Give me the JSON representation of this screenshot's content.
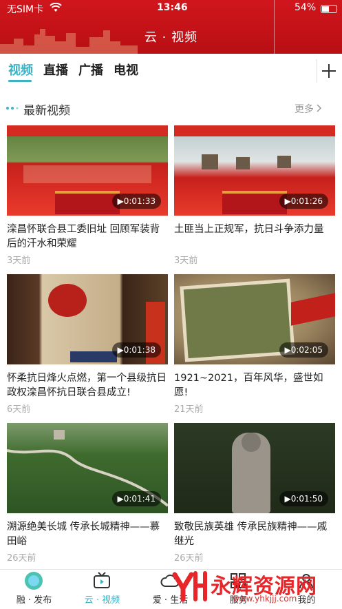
{
  "status_bar": {
    "carrier": "无SIM卡",
    "time": "13:46",
    "battery": "54%"
  },
  "colors": {
    "brand_red": "#c8141a",
    "accent": "#3cb3c3"
  },
  "header": {
    "title": "云 · 视频"
  },
  "tabs": [
    {
      "label": "视频",
      "active": true
    },
    {
      "label": "直播",
      "active": false
    },
    {
      "label": "广播",
      "active": false
    },
    {
      "label": "电视",
      "active": false
    }
  ],
  "add_icon": "plus-icon",
  "section": {
    "title": "最新视频",
    "more": "更多"
  },
  "videos": [
    {
      "title": "滦昌怀联合县工委旧址 回顾军装背后的汗水和荣耀",
      "date": "3天前",
      "duration": "0:01:33"
    },
    {
      "title": "土匪当上正规军，抗日斗争添力量",
      "date": "3天前",
      "duration": "0:01:26"
    },
    {
      "title": "怀柔抗日烽火点燃，第一个县级抗日政权滦昌怀抗日联合县成立!",
      "date": "6天前",
      "duration": "0:01:38"
    },
    {
      "title": "1921~2021，百年风华，盛世如愿!",
      "date": "21天前",
      "duration": "0:02:05"
    },
    {
      "title": "溯源绝美长城 传承长城精神——慕田峪",
      "date": "26天前",
      "duration": "0:01:41"
    },
    {
      "title": "致敬民族英雄 传承民族精神——戚继光",
      "date": "26天前",
      "duration": "0:01:50"
    }
  ],
  "tabbar": [
    {
      "label": "融 · 发布",
      "icon": "rong-logo-icon",
      "active": false
    },
    {
      "label": "云 · 视频",
      "icon": "tv-icon",
      "active": true
    },
    {
      "label": "爱 · 生活",
      "icon": "cloud-icon",
      "active": false
    },
    {
      "label": "服务",
      "icon": "grid-icon",
      "active": false
    },
    {
      "label": "我的",
      "icon": "user-icon",
      "active": false
    }
  ],
  "watermark": {
    "text": "永辉资源网",
    "url": "www.yhkjjj.com"
  }
}
